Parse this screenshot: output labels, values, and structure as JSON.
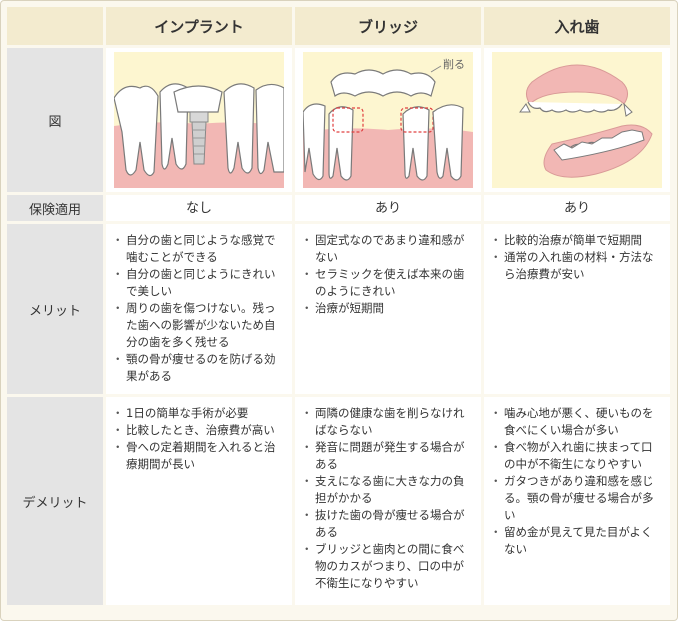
{
  "header": {
    "implant": "インプラント",
    "bridge": "ブリッジ",
    "denture": "入れ歯"
  },
  "rows": {
    "diagram": "図",
    "insurance": "保険適用",
    "merit": "メリット",
    "demerit": "デメリット"
  },
  "diagram": {
    "bridge_note": "削る"
  },
  "insurance": {
    "implant": "なし",
    "bridge": "あり",
    "denture": "あり"
  },
  "merit": {
    "implant": [
      "自分の歯と同じような感覚で噛むことができる",
      "自分の歯と同じようにきれいで美しい",
      "周りの歯を傷つけない。残った歯への影響が少ないため自分の歯を多く残せる",
      "顎の骨が痩せるのを防げる効果がある"
    ],
    "bridge": [
      "固定式なのであまり違和感がない",
      "セラミックを使えば本来の歯のようにきれい",
      "治療が短期間"
    ],
    "denture": [
      "比較的治療が簡単で短期間",
      "通常の入れ歯の材料・方法なら治療費が安い"
    ]
  },
  "demerit": {
    "implant": [
      "1日の簡単な手術が必要",
      "比較したとき、治療費が高い",
      "骨への定着期間を入れると治療期間が長い"
    ],
    "bridge": [
      "両隣の健康な歯を削らなければならない",
      "発音に問題が発生する場合がある",
      "支えになる歯に大きな力の負担がかかる",
      "抜けた歯の骨が痩せる場合がある",
      "ブリッジと歯肉との間に食べ物のカスがつまり、口の中が不衛生になりやすい"
    ],
    "denture": [
      "噛み心地が悪く、硬いものを食べにくい場合が多い",
      "食べ物が入れ歯に挟まって口の中が不衛生になりやすい",
      "ガタつきがあり違和感を感じる。顎の骨が痩せる場合が多い",
      "留め金が見えて見た目がよくない"
    ]
  },
  "colors": {
    "picture_bg": "#fdf6d0",
    "gum": "#f2b7b4",
    "tooth": "#ffffff",
    "outline": "#7a7a7a",
    "dash": "#e04040"
  }
}
